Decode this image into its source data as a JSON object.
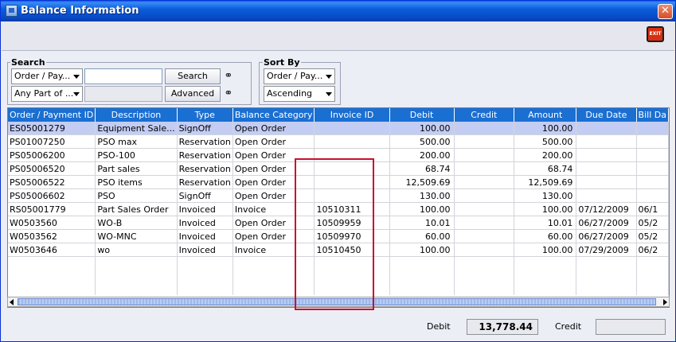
{
  "window": {
    "title": "Balance Information",
    "close_label": "✕"
  },
  "toolbar": {
    "exit_label": "EXIT"
  },
  "search": {
    "group_label": "Search",
    "field_select": "Order / Pay...",
    "match_select": "Any Part of ...",
    "search_button": "Search",
    "advanced_button": "Advanced",
    "input_value": ""
  },
  "sort": {
    "group_label": "Sort By",
    "field_select": "Order / Pay...",
    "order_select": "Ascending"
  },
  "table": {
    "columns": [
      "Order / Payment ID",
      "Description",
      "Type",
      "Balance Category",
      "Invoice ID",
      "Debit",
      "Credit",
      "Amount",
      "Due Date",
      "Bill Da"
    ],
    "rows": [
      [
        "ES05001279",
        "Equipment Sale...",
        "SignOff",
        "Open Order",
        "",
        "100.00",
        "",
        "100.00",
        "",
        ""
      ],
      [
        "PS01007250",
        "PSO max",
        "Reservation",
        "Open Order",
        "",
        "500.00",
        "",
        "500.00",
        "",
        ""
      ],
      [
        "PS05006200",
        "PSO-100",
        "Reservation",
        "Open Order",
        "",
        "200.00",
        "",
        "200.00",
        "",
        ""
      ],
      [
        "PS05006520",
        "Part sales",
        "Reservation",
        "Open Order",
        "",
        "68.74",
        "",
        "68.74",
        "",
        ""
      ],
      [
        "PS05006522",
        "PSO items",
        "Reservation",
        "Open Order",
        "",
        "12,509.69",
        "",
        "12,509.69",
        "",
        ""
      ],
      [
        "PS05006602",
        "PSO",
        "SignOff",
        "Open Order",
        "",
        "130.00",
        "",
        "130.00",
        "",
        ""
      ],
      [
        "RS05001779",
        "Part Sales Order",
        "Invoiced",
        "Invoice",
        "10510311",
        "100.00",
        "",
        "100.00",
        "07/12/2009",
        "06/1"
      ],
      [
        "W0503560",
        "WO-B",
        "Invoiced",
        "Open Order",
        "10509959",
        "10.01",
        "",
        "10.01",
        "06/27/2009",
        "05/2"
      ],
      [
        "W0503562",
        "WO-MNC",
        "Invoiced",
        "Open Order",
        "10509970",
        "60.00",
        "",
        "60.00",
        "06/27/2009",
        "05/2"
      ],
      [
        "W0503646",
        "wo",
        "Invoiced",
        "Invoice",
        "10510450",
        "100.00",
        "",
        "100.00",
        "07/29/2009",
        "06/2"
      ]
    ],
    "selected_row": 0
  },
  "footer": {
    "debit_label": "Debit",
    "debit_value": "13,778.44",
    "credit_label": "Credit",
    "credit_value": ""
  },
  "colors": {
    "header_bg": "#1a6fd2",
    "selected_row": "#c3cdf4",
    "highlight": "#c8102e"
  }
}
